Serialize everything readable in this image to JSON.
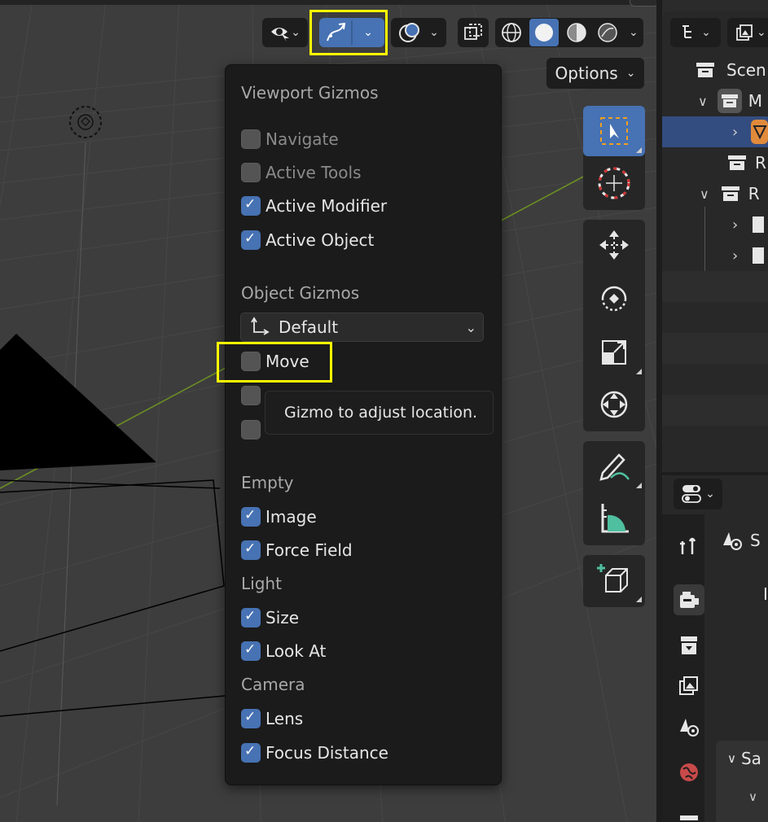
{
  "header": {
    "gizmo_toggle_icon": "gizmo-arrow-icon",
    "caret": "⌄"
  },
  "viewport": {
    "options_label": "Options",
    "options_caret": "⌄"
  },
  "gizmo_popup": {
    "viewport_section": {
      "title": "Viewport Gizmos",
      "items": [
        {
          "label": "Navigate",
          "checked": false
        },
        {
          "label": "Active Tools",
          "checked": false
        },
        {
          "label": "Active Modifier",
          "checked": true
        },
        {
          "label": "Active Object",
          "checked": true
        }
      ]
    },
    "object_section": {
      "title": "Object Gizmos",
      "orientation_value": "Default",
      "items": [
        {
          "label": "Move",
          "checked": false
        }
      ]
    },
    "tooltip": "Gizmo to adjust location.",
    "empty_section": {
      "title": "Empty",
      "items": [
        {
          "label": "Image",
          "checked": true
        },
        {
          "label": "Force Field",
          "checked": true
        }
      ]
    },
    "light_section": {
      "title": "Light",
      "items": [
        {
          "label": "Size",
          "checked": true
        },
        {
          "label": "Look At",
          "checked": true
        }
      ]
    },
    "camera_section": {
      "title": "Camera",
      "items": [
        {
          "label": "Lens",
          "checked": true
        },
        {
          "label": "Focus Distance",
          "checked": true
        }
      ]
    }
  },
  "outliner": {
    "rows": [
      {
        "label": "Scen"
      },
      {
        "label": "M"
      },
      {
        "label": ""
      },
      {
        "label": "R"
      },
      {
        "label": "R"
      }
    ]
  },
  "properties": {
    "panel_label": "S",
    "subpanel_label": "Sa",
    "extra_label": "I"
  },
  "colors": {
    "accent": "#4772b3",
    "highlight": "#ffff00",
    "popup_bg": "#1b1b1b",
    "viewport_bg": "#3d3d3d"
  }
}
